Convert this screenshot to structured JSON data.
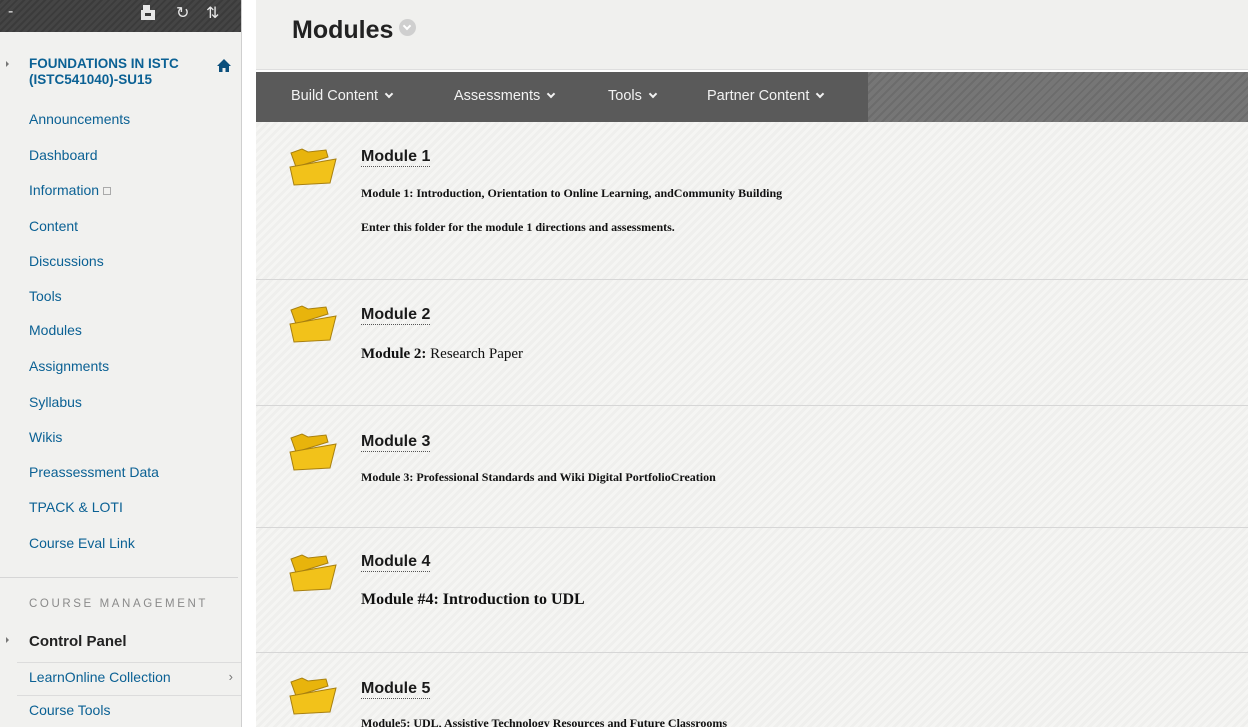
{
  "sidebar": {
    "course_title": "FOUNDATIONS IN ISTC (ISTC541040)-SU15",
    "items": [
      {
        "label": "Announcements"
      },
      {
        "label": "Dashboard"
      },
      {
        "label": "Information"
      },
      {
        "label": "Content"
      },
      {
        "label": "Discussions"
      },
      {
        "label": "Tools"
      },
      {
        "label": "Modules"
      },
      {
        "label": "Assignments"
      },
      {
        "label": "Syllabus"
      },
      {
        "label": "Wikis"
      },
      {
        "label": "Preassessment Data"
      },
      {
        "label": "TPACK & LOTI"
      },
      {
        "label": "Course Eval Link"
      }
    ],
    "management_heading": "COURSE MANAGEMENT",
    "control_panel": "Control Panel",
    "sub_items": [
      {
        "label": "LearnOnline Collection",
        "chevron": "›"
      },
      {
        "label": "Course Tools"
      }
    ]
  },
  "page": {
    "title": "Modules"
  },
  "toolbar": {
    "items": [
      {
        "label": "Build Content"
      },
      {
        "label": "Assessments"
      },
      {
        "label": "Tools"
      },
      {
        "label": "Partner Content"
      }
    ]
  },
  "modules": [
    {
      "title": "Module 1",
      "desc_bold": "Module 1: Introduction, Orientation to Online Learning, andCommunity Building",
      "desc_line2": "Enter this folder for the module 1 directions and assessments."
    },
    {
      "title": "Module 2",
      "desc_bold": "Module 2:",
      "desc_normal": " Research Paper"
    },
    {
      "title": "Module 3",
      "desc_bold": "Module 3: Professional Standards and Wiki Digital PortfolioCreation"
    },
    {
      "title": "Module 4",
      "desc_bold": "Module #4: Introduction to UDL"
    },
    {
      "title": "Module 5",
      "desc_bold": "Module5: UDL, Assistive Technology Resources and Future Classrooms"
    }
  ],
  "colors": {
    "link_blue": "#0b6194",
    "folder_yellow": "#f2c21a",
    "toolbar_dark": "#5a5a5a"
  }
}
